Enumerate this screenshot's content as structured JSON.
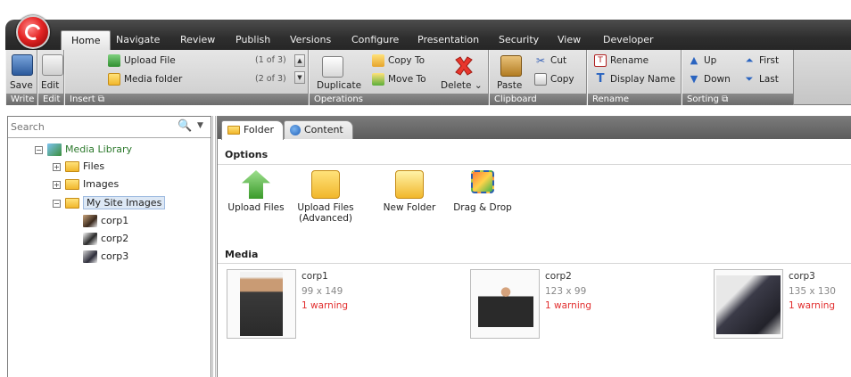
{
  "ribbon": {
    "tabs": [
      "Home",
      "Navigate",
      "Review",
      "Publish",
      "Versions",
      "Configure",
      "Presentation",
      "Security",
      "View",
      "Developer"
    ],
    "active_tab": "Home",
    "groups": {
      "write": {
        "label": "Write",
        "save": "Save"
      },
      "edit": {
        "label": "Edit",
        "edit": "Edit"
      },
      "insert": {
        "label": "Insert",
        "upload_file": "Upload File",
        "upload_file_count": "(1 of 3)",
        "media_folder": "Media folder",
        "media_folder_count": "(2 of 3)"
      },
      "operations": {
        "label": "Operations",
        "duplicate": "Duplicate",
        "copy_to": "Copy To",
        "move_to": "Move To",
        "delete": "Delete"
      },
      "clipboard": {
        "label": "Clipboard",
        "paste": "Paste",
        "cut": "Cut",
        "copy": "Copy"
      },
      "rename": {
        "label": "Rename",
        "rename": "Rename",
        "display_name": "Display Name"
      },
      "sorting": {
        "label": "Sorting",
        "up": "Up",
        "down": "Down",
        "first": "First",
        "last": "Last"
      }
    }
  },
  "search": {
    "placeholder": "Search"
  },
  "tree": {
    "root": "Media Library",
    "items": [
      "Files",
      "Images",
      "My Site Images"
    ],
    "children": [
      "corp1",
      "corp2",
      "corp3"
    ]
  },
  "content_tabs": [
    "Folder",
    "Content"
  ],
  "options": {
    "title": "Options",
    "items": [
      "Upload Files",
      "Upload Files\n(Advanced)",
      "New Folder",
      "Drag & Drop"
    ]
  },
  "media": {
    "title": "Media",
    "items": [
      {
        "name": "corp1",
        "dims": "99 x 149",
        "warning": "1 warning"
      },
      {
        "name": "corp2",
        "dims": "123 x 99",
        "warning": "1 warning"
      },
      {
        "name": "corp3",
        "dims": "135 x 130",
        "warning": "1 warning"
      }
    ]
  },
  "colors": {
    "ribbon_dark": "#2e2e2e",
    "warning": "#e23030",
    "tree_selected": "#dde8f5"
  }
}
